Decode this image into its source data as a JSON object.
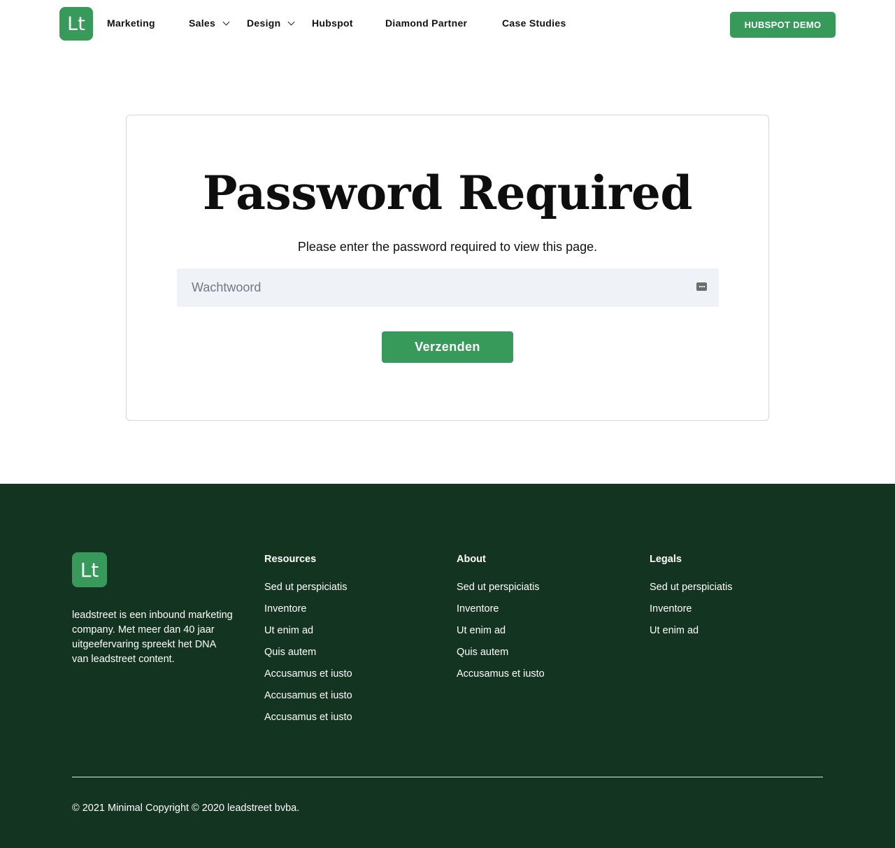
{
  "header": {
    "logo_text": "Lt",
    "nav": [
      {
        "label": "Marketing",
        "dropdown": false
      },
      {
        "label": "Sales",
        "dropdown": true
      },
      {
        "label": "Design",
        "dropdown": true
      },
      {
        "label": "Hubspot",
        "dropdown": false
      },
      {
        "label": "Diamond Partner",
        "dropdown": false
      },
      {
        "label": "Case Studies",
        "dropdown": false
      }
    ],
    "cta_label": "HUBSPOT DEMO"
  },
  "password_card": {
    "title": "Password Required",
    "subtitle": "Please enter the password required to view this page.",
    "input_placeholder": "Wachtwoord",
    "input_value": "",
    "input_icon": "password-dots-icon",
    "submit_label": "Verzenden"
  },
  "footer": {
    "logo_text": "Lt",
    "about_text": "leadstreet is een inbound marketing company. Met meer dan 40 jaar uitgeefervaring spreekt het DNA van leadstreet content.",
    "columns": [
      {
        "heading": "Resources",
        "links": [
          "Sed ut perspiciatis",
          "Inventore",
          "Ut enim ad",
          "Quis autem",
          "Accusamus et iusto",
          "Accusamus et iusto",
          "Accusamus et iusto"
        ]
      },
      {
        "heading": "About",
        "links": [
          "Sed ut perspiciatis",
          "Inventore",
          "Ut enim ad",
          "Quis autem",
          "Accusamus et iusto"
        ]
      },
      {
        "heading": "Legals",
        "links": [
          "Sed ut perspiciatis",
          "Inventore",
          "Ut enim ad"
        ]
      }
    ],
    "copyright": "© 2021 Minimal Copyright © 2020 leadstreet bvba."
  },
  "colors": {
    "brand_green": "#389a5a",
    "footer_bg": "#123420",
    "input_bg": "#eff2f6"
  }
}
